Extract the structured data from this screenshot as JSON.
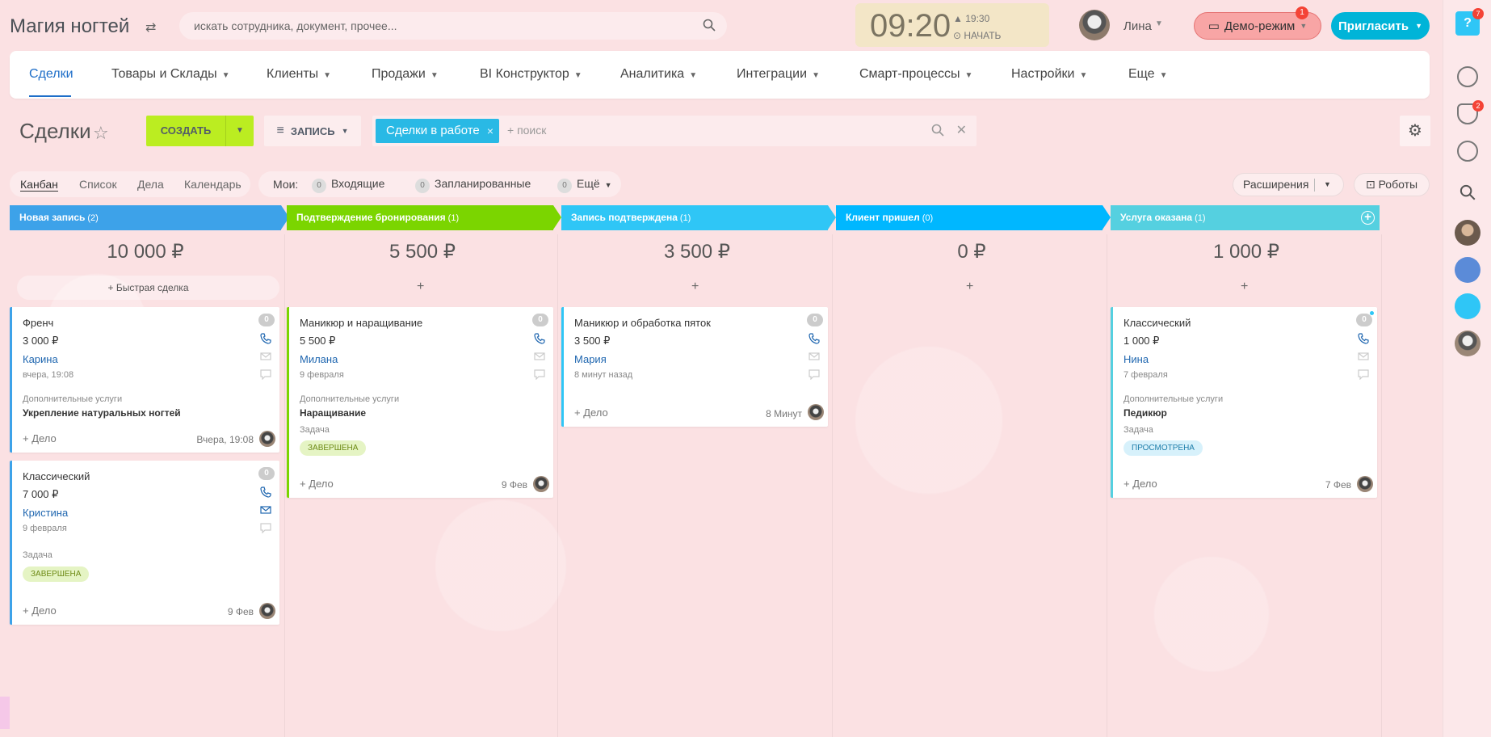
{
  "header": {
    "app_title": "Магия ногтей",
    "search_placeholder": "искать сотрудника, документ, прочее...",
    "clock_time": "09:20",
    "clock_alarm": "19:30",
    "clock_start": "НАЧАТЬ",
    "user_name": "Лина",
    "demo_label": "Демо-режим",
    "demo_badge": "1",
    "invite_label": "Пригласить",
    "help_badge": "7",
    "bell_badge": "2"
  },
  "nav": {
    "items": [
      "Сделки",
      "Товары и Склады",
      "Клиенты",
      "Продажи",
      "BI Конструктор",
      "Аналитика",
      "Интеграции",
      "Смарт-процессы",
      "Настройки",
      "Еще"
    ]
  },
  "toolbar": {
    "page_title": "Сделки",
    "create_label": "СОЗДАТЬ",
    "filter_label": "ЗАПИСЬ",
    "filter_chip": "Сделки в работе",
    "filter_search_placeholder": "+ поиск"
  },
  "views": {
    "tabs": [
      "Канбан",
      "Список",
      "Дела",
      "Календарь"
    ],
    "my_label": "Мои:",
    "my_items": [
      {
        "count": "0",
        "label": "Входящие"
      },
      {
        "count": "0",
        "label": "Запланированные"
      },
      {
        "count": "0",
        "label": "Ещё"
      }
    ],
    "extensions_label": "Расширения",
    "robots_label": "Роботы"
  },
  "colors": {
    "stage_1": "#3da2e9",
    "stage_2": "#7bd500",
    "stage_3": "#2fc6f6",
    "stage_4": "#00b7ff",
    "stage_5": "#55d0e0"
  },
  "stages": [
    {
      "name": "Новая запись",
      "count": "(2)",
      "sum": "10 000 ₽"
    },
    {
      "name": "Подтверждение бронирования",
      "count": "(1)",
      "sum": "5 500 ₽"
    },
    {
      "name": "Запись подтверждена",
      "count": "(1)",
      "sum": "3 500 ₽"
    },
    {
      "name": "Клиент пришел",
      "count": "(0)",
      "sum": "0 ₽"
    },
    {
      "name": "Услуга оказана",
      "count": "(1)",
      "sum": "1 000 ₽"
    }
  ],
  "quick_deal_label": "Быстрая сделка",
  "cards": {
    "c1": {
      "title": "Френч",
      "badge": "0",
      "price": "3 000 ₽",
      "client": "Карина",
      "date": "вчера, 19:08",
      "extra_label": "Дополнительные услуги",
      "extra_value": "Укрепление натуральных ногтей",
      "add": "+ Дело",
      "when": "Вчера, 19:08"
    },
    "c2": {
      "title": "Классический",
      "badge": "0",
      "price": "7 000 ₽",
      "client": "Кристина",
      "date": "9 февраля",
      "task_label": "Задача",
      "task_status": "ЗАВЕРШЕНА",
      "add": "+ Дело",
      "when": "9 Фев"
    },
    "c3": {
      "title": "Маникюр и наращивание",
      "badge": "0",
      "price": "5 500 ₽",
      "client": "Милана",
      "date": "9 февраля",
      "extra_label": "Дополнительные услуги",
      "extra_value": "Наращивание",
      "task_label": "Задача",
      "task_status": "ЗАВЕРШЕНА",
      "add": "+ Дело",
      "when": "9 Фев"
    },
    "c4": {
      "title": "Маникюр и обработка пяток",
      "badge": "0",
      "price": "3 500 ₽",
      "client": "Мария",
      "date": "8 минут назад",
      "add": "+ Дело",
      "when": "8 Минут"
    },
    "c5": {
      "title": "Классический",
      "badge": "0",
      "price": "1 000 ₽",
      "client": "Нина",
      "date": "7 февраля",
      "extra_label": "Дополнительные услуги",
      "extra_value": "Педикюр",
      "task_label": "Задача",
      "task_status": "ПРОСМОТРЕНА",
      "add": "+ Дело",
      "when": "7 Фев"
    }
  }
}
